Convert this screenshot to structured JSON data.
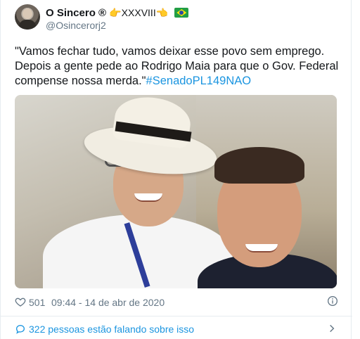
{
  "author": {
    "name": "O Sincero ®",
    "name_suffix": "👉XXXVIII👈",
    "handle": "@Osincerorj2"
  },
  "tweet": {
    "text": "\"Vamos fechar tudo, vamos deixar esse povo sem emprego. Depois a gente pede ao Rodrigo Maia para que o Gov. Federal compense nossa merda.\"",
    "hashtag": "#SenadoPL149NAO"
  },
  "meta": {
    "likes": "501",
    "timestamp": "09:44 - 14 de abr de 2020"
  },
  "conversation": {
    "label": "322 pessoas estão falando sobre isso"
  },
  "colors": {
    "link": "#1b95e0",
    "secondary_text": "#657786",
    "border": "#e6ecf0"
  },
  "icons": [
    "heart-icon",
    "info-icon",
    "speech-bubble-icon",
    "chevron-right-icon",
    "brazil-flag-icon"
  ]
}
